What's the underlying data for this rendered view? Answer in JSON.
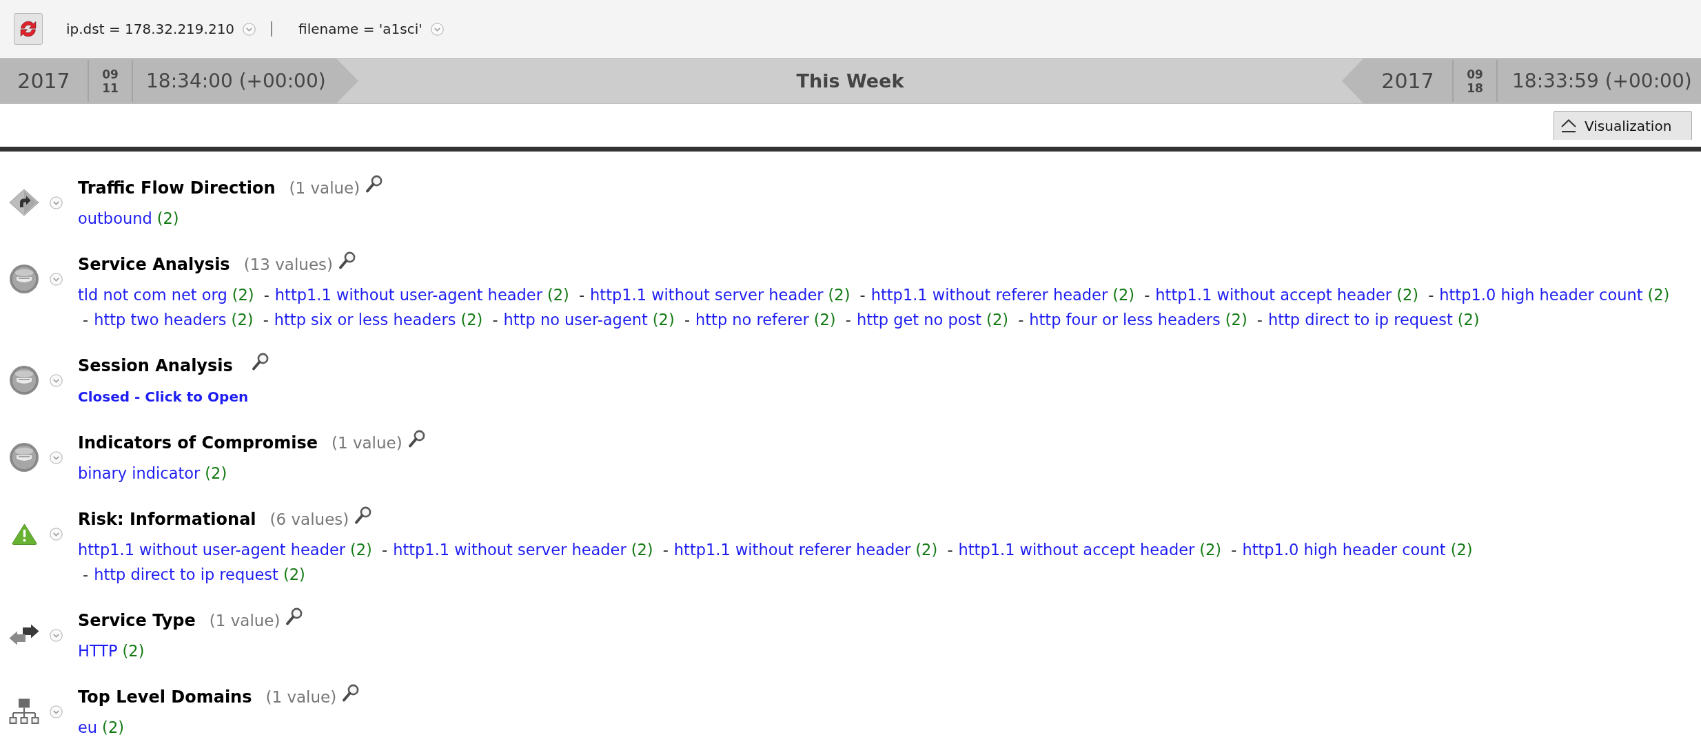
{
  "toolbar": {
    "filters": [
      {
        "label": "ip.dst = 178.32.219.210"
      },
      {
        "label": "filename = 'a1sci'"
      }
    ]
  },
  "time_range": {
    "start": {
      "year": "2017",
      "month": "09",
      "day": "11",
      "time": "18:34:00 (+00:00)"
    },
    "label": "This Week",
    "end": {
      "year": "2017",
      "month": "09",
      "day": "18",
      "time": "18:33:59 (+00:00)"
    }
  },
  "visualization_button": {
    "label": "Visualization"
  },
  "sections": [
    {
      "kind": "direction",
      "title": "Traffic Flow Direction",
      "count": "(1 value)",
      "values": [
        {
          "label": "outbound",
          "count": "(2)"
        }
      ]
    },
    {
      "kind": "analysis",
      "title": "Service Analysis",
      "count": "(13 values)",
      "values": [
        {
          "label": "tld not com net org",
          "count": "(2)"
        },
        {
          "separator": "-",
          "label": "http1.1 without user-agent header",
          "count": "(2)"
        },
        {
          "separator": "-",
          "label": "http1.1 without server header",
          "count": "(2)"
        },
        {
          "separator": "-",
          "label": "http1.1 without referer header",
          "count": "(2)"
        },
        {
          "separator": "-",
          "label": "http1.1 without accept header",
          "count": "(2)"
        },
        {
          "separator": "-",
          "label": "http1.0 high header count",
          "count": "(2)"
        },
        {
          "separator": "-",
          "label": "http two headers",
          "count": "(2)"
        },
        {
          "separator": "-",
          "label": "http six or less headers",
          "count": "(2)"
        },
        {
          "separator": "-",
          "label": "http no user-agent",
          "count": "(2)"
        },
        {
          "separator": "-",
          "label": "http no referer",
          "count": "(2)"
        },
        {
          "separator": "-",
          "label": "http get no post",
          "count": "(2)"
        },
        {
          "separator": "-",
          "label": "http four or less headers",
          "count": "(2)"
        },
        {
          "separator": "-",
          "label": "http direct to ip request",
          "count": "(2)"
        }
      ]
    },
    {
      "kind": "analysis",
      "title": "Session Analysis",
      "closed_link": "Closed - Click to Open"
    },
    {
      "kind": "analysis",
      "title": "Indicators of Compromise",
      "count": "(1 value)",
      "values": [
        {
          "label": "binary indicator",
          "count": "(2)"
        }
      ]
    },
    {
      "kind": "warning",
      "title": "Risk: Informational",
      "count": "(6 values)",
      "values": [
        {
          "label": "http1.1 without user-agent header",
          "count": "(2)"
        },
        {
          "separator": "-",
          "label": "http1.1 without server header",
          "count": "(2)"
        },
        {
          "separator": "-",
          "label": "http1.1 without referer header",
          "count": "(2)"
        },
        {
          "separator": "-",
          "label": "http1.1 without accept header",
          "count": "(2)"
        },
        {
          "separator": "-",
          "label": "http1.0 high header count",
          "count": "(2)"
        },
        {
          "separator": "-",
          "label": "http direct to ip request",
          "count": "(2)"
        }
      ]
    },
    {
      "kind": "exchange",
      "title": "Service Type",
      "count": "(1 value)",
      "values": [
        {
          "label": "HTTP",
          "count": "(2)"
        }
      ]
    },
    {
      "kind": "network",
      "title": "Top Level Domains",
      "count": "(1 value)",
      "values": [
        {
          "label": "eu",
          "count": "(2)"
        }
      ]
    }
  ]
}
